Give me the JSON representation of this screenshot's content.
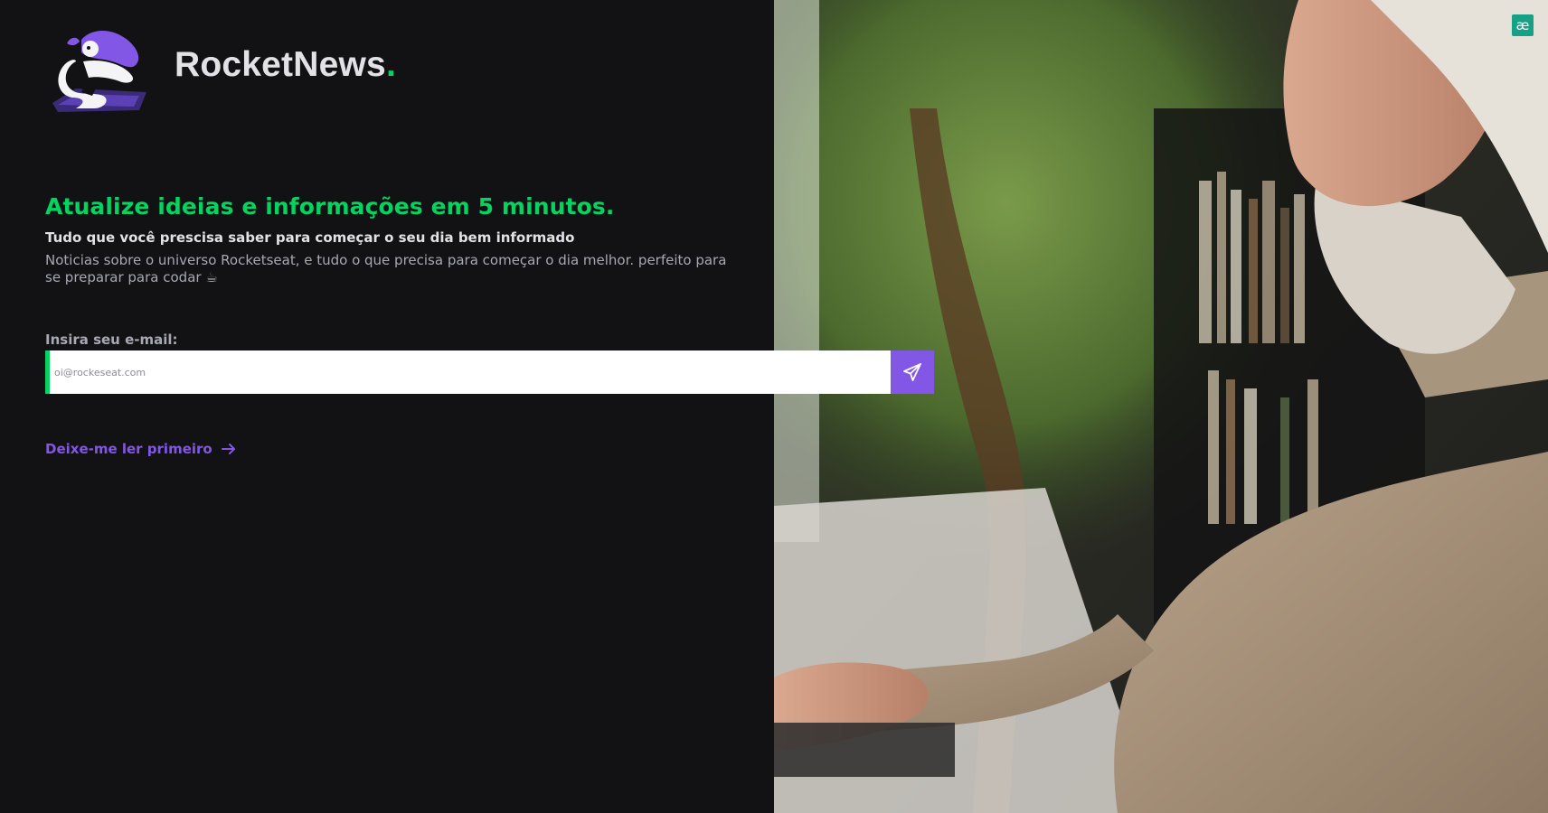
{
  "brand": {
    "name": "RocketNews",
    "dot": ".",
    "accent_color": "#04d361"
  },
  "hero": {
    "headline": "Atualize ideias e informações em 5 minutos.",
    "subhead": "Tudo que você prescisa saber para começar o seu dia bem informado",
    "description": "Noticias sobre o universo Rocketseat, e tudo o que precisa para começar o dia melhor. perfeito para se preparar para codar ☕"
  },
  "form": {
    "label": "Insira seu e-mail:",
    "placeholder": "oi@rockeseat.com",
    "value": "",
    "submit_icon": "send-icon",
    "button_color": "#8257e5"
  },
  "link": {
    "label": "Deixe-me ler primeiro",
    "icon": "arrow-right-icon",
    "color": "#8257e5"
  },
  "extension_badge": {
    "label": "æ",
    "color": "#16a085"
  },
  "colors": {
    "background": "#121214",
    "text_primary": "#e1e1e6",
    "text_secondary": "#a8a8b3"
  }
}
